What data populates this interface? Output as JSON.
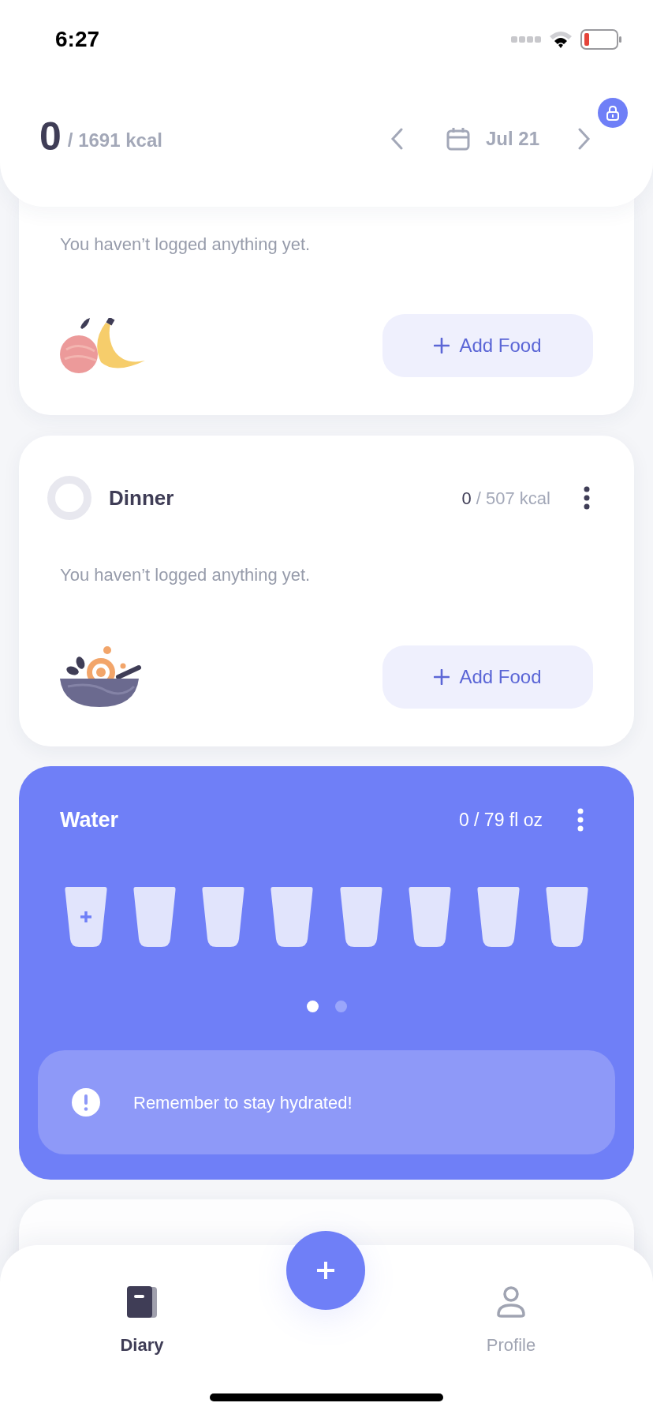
{
  "status_bar": {
    "time": "6:27"
  },
  "header": {
    "consumed": "0",
    "target": "/ 1691 kcal",
    "date": "Jul 21"
  },
  "meals": [
    {
      "kind": "fruit",
      "message": "You haven’t logged anything yet.",
      "button": "Add Food"
    },
    {
      "title": "Dinner",
      "consumed": "0",
      "target": "/ 507 kcal",
      "message": "You haven’t logged anything yet.",
      "kind": "bowl",
      "button": "Add Food"
    }
  ],
  "water": {
    "title": "Water",
    "amount": "0 / 79 fl oz",
    "cups": [
      {
        "kind": "add"
      },
      {
        "kind": "empty"
      },
      {
        "kind": "empty"
      },
      {
        "kind": "empty"
      },
      {
        "kind": "empty"
      },
      {
        "kind": "empty"
      },
      {
        "kind": "empty"
      },
      {
        "kind": "empty"
      }
    ],
    "pages": [
      {
        "selected": true
      },
      {
        "selected": false
      }
    ],
    "reminder": "Remember to stay hydrated!"
  },
  "tab_bar": {
    "tabs": [
      {
        "label": "Diary",
        "kind": "book",
        "selected": true
      },
      {
        "label": "Profile",
        "kind": "person",
        "selected": false
      }
    ]
  }
}
